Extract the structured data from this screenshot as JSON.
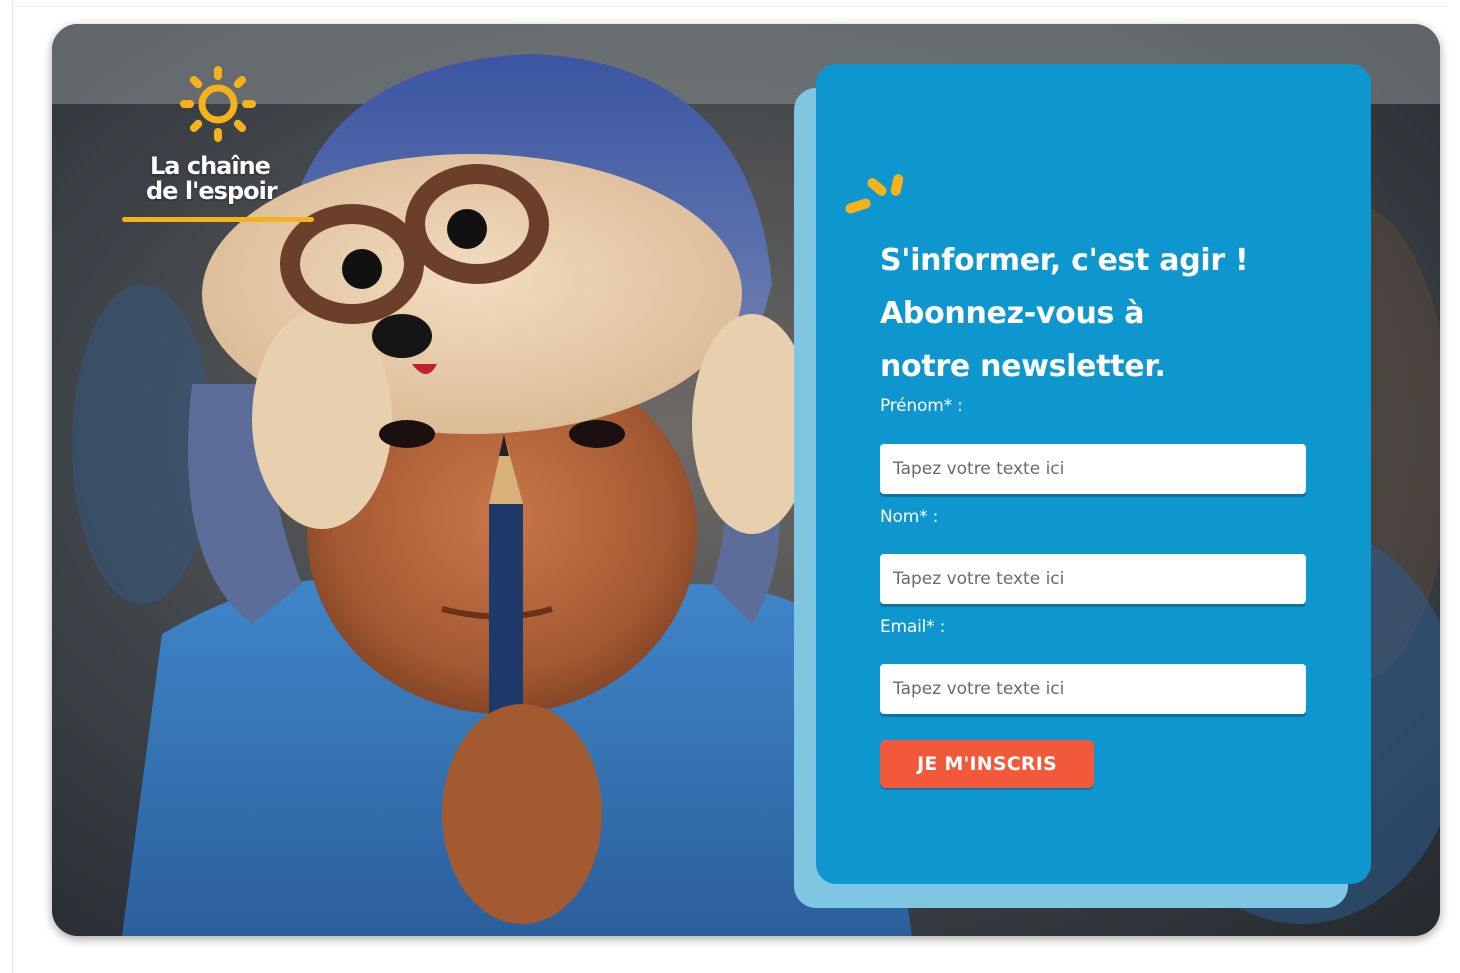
{
  "logo": {
    "line1": "La chaîne",
    "line2": "de l'espoir"
  },
  "newsletter": {
    "title_lines": [
      "S'informer, c'est agir !",
      "Abonnez-vous à",
      "notre newsletter."
    ],
    "fields": [
      {
        "label": "Prénom* :",
        "placeholder": "Tapez votre texte ici",
        "value": ""
      },
      {
        "label": "Nom* :",
        "placeholder": "Tapez votre texte ici",
        "value": ""
      },
      {
        "label": "Email* :",
        "placeholder": "Tapez votre texte ici",
        "value": ""
      }
    ],
    "submit_label": "JE M'INSCRIS"
  },
  "hero_image": {
    "subject": "child-in-knitted-cat-hat-holding-pencil"
  },
  "colors": {
    "card_blue": "#0e97cf",
    "card_shadow_blue": "#7fc6e2",
    "button_orange": "#f2593a",
    "accent_yellow": "#f6b21a",
    "text_white": "#ffffff"
  }
}
